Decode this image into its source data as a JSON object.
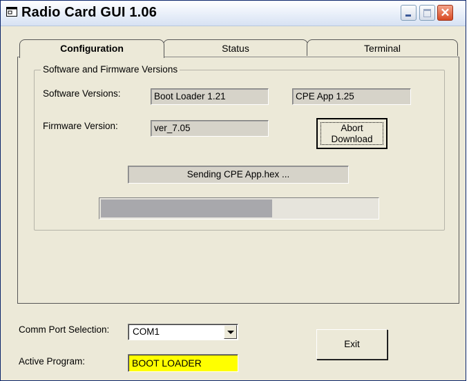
{
  "window": {
    "title": "Radio Card GUI 1.06"
  },
  "tabs": [
    {
      "label": "Configuration",
      "selected": true
    },
    {
      "label": "Status",
      "selected": false
    },
    {
      "label": "Terminal",
      "selected": false
    }
  ],
  "versions_group": {
    "legend": "Software and Firmware Versions",
    "software_label": "Software Versions:",
    "software_boot_loader": "Boot Loader 1.21",
    "software_cpe_app": "CPE App 1.25",
    "firmware_label": "Firmware Version:",
    "firmware_value": "ver_7.05",
    "abort_button_line1": "Abort",
    "abort_button_line2": "Download",
    "status_message": "Sending CPE App.hex ...",
    "progress_fraction": 0.62
  },
  "bottom": {
    "comm_port_label": "Comm Port Selection:",
    "comm_port_value": "COM1",
    "active_program_label": "Active Program:",
    "active_program_value": "BOOT LOADER",
    "exit_label": "Exit"
  },
  "colors": {
    "active_program_bg": "#ffff00",
    "window_bg": "#ece9d8",
    "progress_fill": "#a8a8ac"
  }
}
